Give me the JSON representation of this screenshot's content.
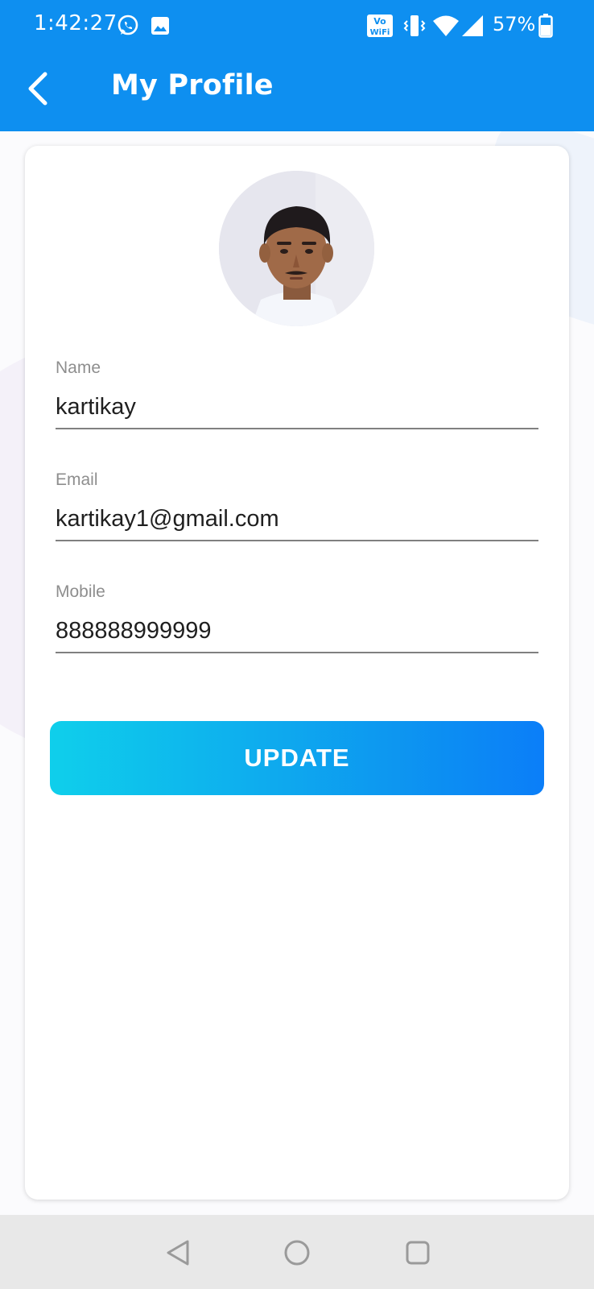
{
  "status_bar": {
    "time": "1:42:27",
    "icons": [
      "whatsapp-icon",
      "gallery-icon",
      "vowifi-icon",
      "vibrate-icon",
      "wifi-icon",
      "signal-icon",
      "battery-icon"
    ],
    "vowifi_top": "Vo",
    "vowifi_bottom": "WiFi",
    "battery": "57%"
  },
  "app_bar": {
    "title": "My Profile",
    "back_icon": "chevron-left-icon"
  },
  "profile": {
    "avatar_icon": "avatar-photo",
    "fields": [
      {
        "label": "Name",
        "value": "kartikay"
      },
      {
        "label": "Email",
        "value": "kartikay1@gmail.com"
      },
      {
        "label": "Mobile",
        "value": "888888999999"
      }
    ],
    "update_label": "UPDATE"
  },
  "nav_bar": {
    "icons": [
      "back-triangle-icon",
      "home-circle-icon",
      "recents-square-icon"
    ]
  },
  "colors": {
    "primary": "#0e8ff0",
    "button_gradient_start": "#0fcfeb",
    "button_gradient_end": "#0b7ef8",
    "nav_bar": "#e8e8e8"
  }
}
